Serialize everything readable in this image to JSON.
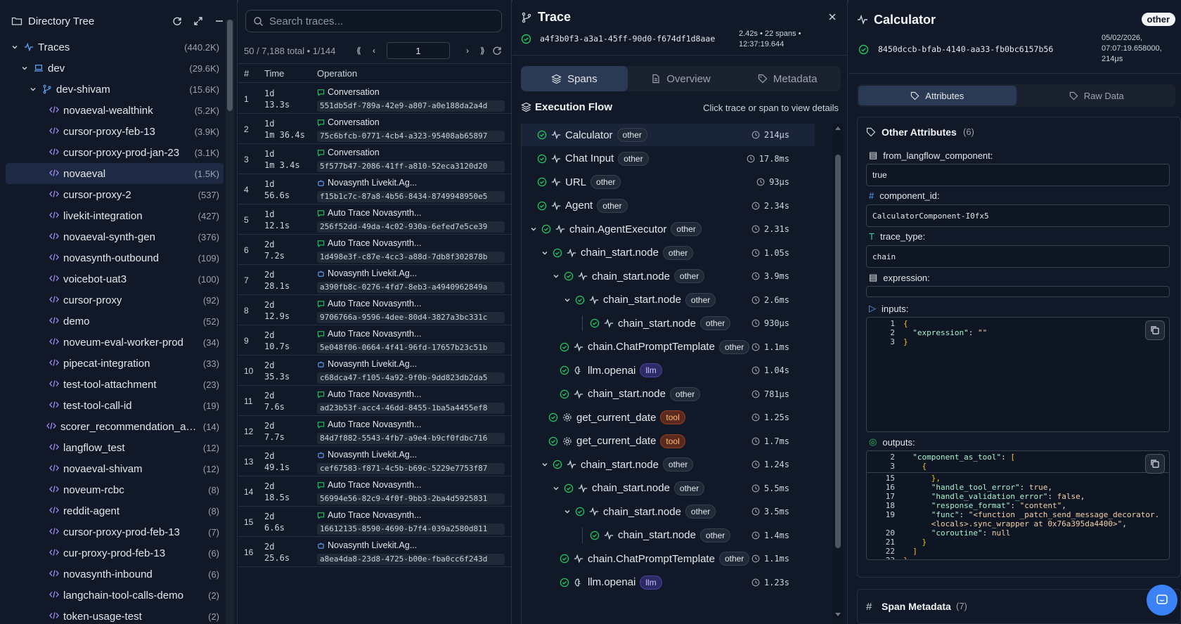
{
  "tree": {
    "title": "Directory Tree",
    "items": [
      {
        "label": "Traces",
        "count": "(440.2K)"
      },
      {
        "label": "dev",
        "count": "(29.6K)"
      },
      {
        "label": "dev-shivam",
        "count": "(15.6K)"
      },
      {
        "label": "novaeval-wealthink",
        "count": "(5.2K)"
      },
      {
        "label": "cursor-proxy-feb-13",
        "count": "(3.9K)"
      },
      {
        "label": "cursor-proxy-prod-jan-23",
        "count": "(3.1K)"
      },
      {
        "label": "novaeval",
        "count": "(1.5K)"
      },
      {
        "label": "cursor-proxy-2",
        "count": "(537)"
      },
      {
        "label": "livekit-integration",
        "count": "(427)"
      },
      {
        "label": "novaeval-synth-gen",
        "count": "(376)"
      },
      {
        "label": "novasynth-outbound",
        "count": "(109)"
      },
      {
        "label": "voicebot-uat3",
        "count": "(100)"
      },
      {
        "label": "cursor-proxy",
        "count": "(92)"
      },
      {
        "label": "demo",
        "count": "(52)"
      },
      {
        "label": "noveum-eval-worker-prod",
        "count": "(34)"
      },
      {
        "label": "pipecat-integration",
        "count": "(33)"
      },
      {
        "label": "test-tool-attachment",
        "count": "(23)"
      },
      {
        "label": "test-tool-call-id",
        "count": "(19)"
      },
      {
        "label": "scorer_recommendation_a…",
        "count": "(14)"
      },
      {
        "label": "langflow_test",
        "count": "(12)"
      },
      {
        "label": "novaeval-shivam",
        "count": "(12)"
      },
      {
        "label": "noveum-rcbc",
        "count": "(8)"
      },
      {
        "label": "reddit-agent",
        "count": "(8)"
      },
      {
        "label": "cursor-proxy-prod-feb-13",
        "count": "(7)"
      },
      {
        "label": "cur-proxy-prod-feb-13",
        "count": "(6)"
      },
      {
        "label": "novasynth-inbound",
        "count": "(6)"
      },
      {
        "label": "langchain-tool-calls-demo",
        "count": "(2)"
      },
      {
        "label": "token-usage-test",
        "count": "(2)"
      }
    ]
  },
  "traces": {
    "search_placeholder": "Search traces...",
    "summary": "50 / 7,188 total • 1/144",
    "page": "1",
    "headers": {
      "num": "#",
      "time": "Time",
      "op": "Operation"
    },
    "rows": [
      {
        "n": "1",
        "t1": "1d",
        "t2": "13.3s",
        "op": "Conversation",
        "icon": "chat",
        "id": "551db5df-789a-42e9-a807-a0e188da2a4d"
      },
      {
        "n": "2",
        "t1": "1d",
        "t2": "1m 36.4s",
        "op": "Conversation",
        "icon": "chat",
        "id": "75c6bfcb-0771-4cb4-a323-95408ab65897"
      },
      {
        "n": "3",
        "t1": "1d",
        "t2": "1m 3.4s",
        "op": "Conversation",
        "icon": "chat",
        "id": "5f577b47-2086-41ff-a810-52eca3120d20"
      },
      {
        "n": "4",
        "t1": "1d",
        "t2": "56.6s",
        "op": "Novasynth Livekit.Ag...",
        "icon": "bot",
        "id": "f15b1c7c-87a8-4b56-8434-8749948950e5"
      },
      {
        "n": "5",
        "t1": "1d",
        "t2": "12.1s",
        "op": "Auto Trace Novasynth...",
        "icon": "chat",
        "id": "256f52dd-49da-4c02-930a-6efed7e5ce39"
      },
      {
        "n": "6",
        "t1": "2d",
        "t2": "7.2s",
        "op": "Auto Trace Novasynth...",
        "icon": "chat",
        "id": "1d498e3f-c87e-4cc3-a88d-7db8f302878b"
      },
      {
        "n": "7",
        "t1": "2d",
        "t2": "28.1s",
        "op": "Novasynth Livekit.Ag...",
        "icon": "bot",
        "id": "a390fb8c-0276-4fd7-8eb3-a4940962849a"
      },
      {
        "n": "8",
        "t1": "2d",
        "t2": "12.9s",
        "op": "Auto Trace Novasynth...",
        "icon": "chat",
        "id": "9706766a-9596-4dee-80d4-3827a3bc331c"
      },
      {
        "n": "9",
        "t1": "2d",
        "t2": "10.7s",
        "op": "Auto Trace Novasynth...",
        "icon": "chat",
        "id": "5e048f06-0664-4f41-96fd-17657b23c51b"
      },
      {
        "n": "10",
        "t1": "2d",
        "t2": "35.3s",
        "op": "Novasynth Livekit.Ag...",
        "icon": "bot",
        "id": "c68dca47-f105-4a92-9f0b-9dd823db2da5"
      },
      {
        "n": "11",
        "t1": "2d",
        "t2": "7.6s",
        "op": "Auto Trace Novasynth...",
        "icon": "chat",
        "id": "ad23b53f-acc4-46dd-8455-1ba5a4455ef8"
      },
      {
        "n": "12",
        "t1": "2d",
        "t2": "7.7s",
        "op": "Auto Trace Novasynth...",
        "icon": "chat",
        "id": "84d7f882-5543-4fb7-a9e4-b9cf0fdbc716"
      },
      {
        "n": "13",
        "t1": "2d",
        "t2": "49.1s",
        "op": "Novasynth Livekit.Ag...",
        "icon": "bot",
        "id": "cef67583-f871-4c5b-b69c-5229e7753f87"
      },
      {
        "n": "14",
        "t1": "2d",
        "t2": "18.5s",
        "op": "Auto Trace Novasynth...",
        "icon": "chat",
        "id": "56994e56-82c9-4f0f-9bb3-2ba4d5925831"
      },
      {
        "n": "15",
        "t1": "2d",
        "t2": "6.6s",
        "op": "Auto Trace Novasynth...",
        "icon": "chat",
        "id": "16612135-8590-4690-b7f4-039a2580d811"
      },
      {
        "n": "16",
        "t1": "2d",
        "t2": "25.6s",
        "op": "Novasynth Livekit.Ag...",
        "icon": "bot",
        "id": "a8ea4da8-23d8-4725-b00e-fba0cc6f243d"
      }
    ]
  },
  "trace": {
    "title": "Trace",
    "id": "a4f3b0f3-a3a1-45ff-90d0-f674df1d8aae",
    "meta1": "2.42s • 22 spans •",
    "meta2": "12:37:19.644",
    "tabs": [
      "Spans",
      "Overview",
      "Metadata"
    ],
    "flow_title": "Execution Flow",
    "flow_hint": "Click trace or span to view details",
    "spans": [
      {
        "label": "Calculator",
        "badge": "other",
        "dur": "214μs"
      },
      {
        "label": "Chat Input",
        "badge": "other",
        "dur": "17.8ms"
      },
      {
        "label": "URL",
        "badge": "other",
        "dur": "93μs"
      },
      {
        "label": "Agent",
        "badge": "other",
        "dur": "2.34s"
      },
      {
        "label": "chain.AgentExecutor",
        "badge": "other",
        "dur": "2.31s"
      },
      {
        "label": "chain_start.node",
        "badge": "other",
        "dur": "1.05s"
      },
      {
        "label": "chain_start.node",
        "badge": "other",
        "dur": "3.9ms"
      },
      {
        "label": "chain_start.node",
        "badge": "other",
        "dur": "2.6ms"
      },
      {
        "label": "chain_start.node",
        "badge": "other",
        "dur": "930μs"
      },
      {
        "label": "chain.ChatPromptTemplate",
        "badge": "other",
        "dur": "1.1ms"
      },
      {
        "label": "llm.openai",
        "badge": "llm",
        "dur": "1.04s"
      },
      {
        "label": "chain_start.node",
        "badge": "other",
        "dur": "781μs"
      },
      {
        "label": "get_current_date",
        "badge": "tool",
        "dur": "1.25s"
      },
      {
        "label": "get_current_date",
        "badge": "tool",
        "dur": "1.7ms"
      },
      {
        "label": "chain_start.node",
        "badge": "other",
        "dur": "1.24s"
      },
      {
        "label": "chain_start.node",
        "badge": "other",
        "dur": "5.5ms"
      },
      {
        "label": "chain_start.node",
        "badge": "other",
        "dur": "3.5ms"
      },
      {
        "label": "chain_start.node",
        "badge": "other",
        "dur": "1.4ms"
      },
      {
        "label": "chain.ChatPromptTemplate",
        "badge": "other",
        "dur": "1.1ms"
      },
      {
        "label": "llm.openai",
        "badge": "llm",
        "dur": "1.23s"
      }
    ]
  },
  "span": {
    "title": "Calculator",
    "badge": "other",
    "id": "8450dccb-bfab-4140-aa33-fb0bc6157b56",
    "date1": "05/02/2026,",
    "date2": "07:07:19.658000,",
    "date3": "214μs",
    "tabs": [
      "Attributes",
      "Raw Data"
    ],
    "section_title": "Other Attributes",
    "section_count": "(6)",
    "attrs": [
      {
        "label": "from_langflow_component:",
        "value": "true"
      },
      {
        "label": "component_id:",
        "value": "CalculatorComponent-I0fx5"
      },
      {
        "label": "trace_type:",
        "value": "chain"
      },
      {
        "label": "expression:",
        "value": ""
      }
    ],
    "inputs_label": "inputs:",
    "outputs_label": "outputs:",
    "meta_title": "Span Metadata",
    "meta_count": "(7)"
  },
  "colors": {
    "accent": "#3b82f6",
    "success": "#22c55e",
    "panel": "#111827"
  }
}
